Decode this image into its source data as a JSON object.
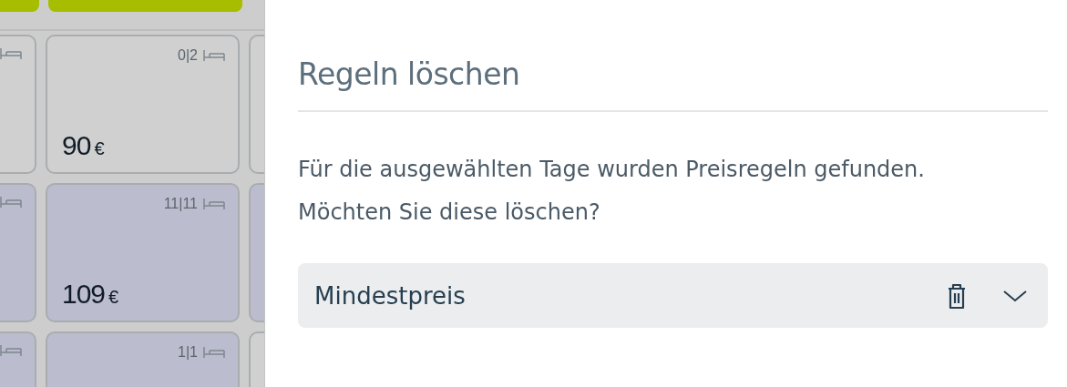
{
  "calendar": {
    "rows": [
      {
        "cells": [
          {
            "booked": false
          },
          {
            "booked": false,
            "count": "0|2",
            "price": "90",
            "currency": "€"
          },
          {
            "booked": false
          }
        ]
      },
      {
        "cells": [
          {
            "booked": true
          },
          {
            "booked": true,
            "count": "11|11",
            "price": "109",
            "currency": "€"
          },
          {
            "booked": true
          }
        ]
      },
      {
        "cells": [
          {
            "booked": true
          },
          {
            "booked": true,
            "count": "1|1"
          },
          {
            "booked": false
          }
        ]
      }
    ]
  },
  "dialog": {
    "title": "Regeln löschen",
    "message": "Für die ausgewählten Tage wurden Preisregeln gefunden. Möchten Sie diese löschen?",
    "rules": [
      {
        "name": "Mindestpreis",
        "expanded": false
      }
    ]
  }
}
